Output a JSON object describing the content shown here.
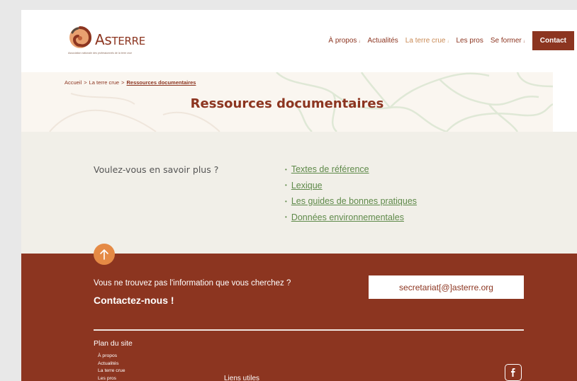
{
  "logo": {
    "name_main": "As",
    "name_rest": "Terre",
    "tagline": "Association nationale des professionnels de la terre crue"
  },
  "nav": {
    "items": [
      {
        "label": "À propos",
        "has_dropdown": true
      },
      {
        "label": "Actualités",
        "has_dropdown": false
      },
      {
        "label": "La terre crue",
        "has_dropdown": true,
        "active": true
      },
      {
        "label": "Les pros",
        "has_dropdown": false
      },
      {
        "label": "Se former",
        "has_dropdown": true
      }
    ],
    "dropdown_marker": "↓",
    "contact_label": "Contact"
  },
  "breadcrumb": {
    "items": [
      "Accueil",
      "La terre crue",
      "Ressources documentaires"
    ],
    "separator": ">"
  },
  "hero": {
    "title": "Ressources documentaires"
  },
  "resources": {
    "question": "Voulez-vous en savoir plus ?",
    "bullet": "•",
    "links": [
      "Textes de référence",
      "Lexique",
      "Les guides de bonnes pratiques",
      "Données environnementales"
    ]
  },
  "footer": {
    "question": "Vous ne trouvez pas l'information que vous cherchez ?",
    "cta": "Contactez-nous !",
    "email": "secretariat[@]asterre.org",
    "sitemap_title": "Plan du site",
    "sitemap_items": [
      "À propos",
      "Actualités",
      "La terre crue",
      "Les pros"
    ],
    "useful_links_title": "Liens utiles"
  },
  "colors": {
    "brand": "#8c3520",
    "accent_orange": "#e58a45",
    "link_green": "#5f8a4a",
    "beige": "#f1efe8"
  },
  "icons": {
    "logo": "spiral-logo-icon",
    "scroll_top": "arrow-up-icon",
    "social": "facebook-icon"
  }
}
